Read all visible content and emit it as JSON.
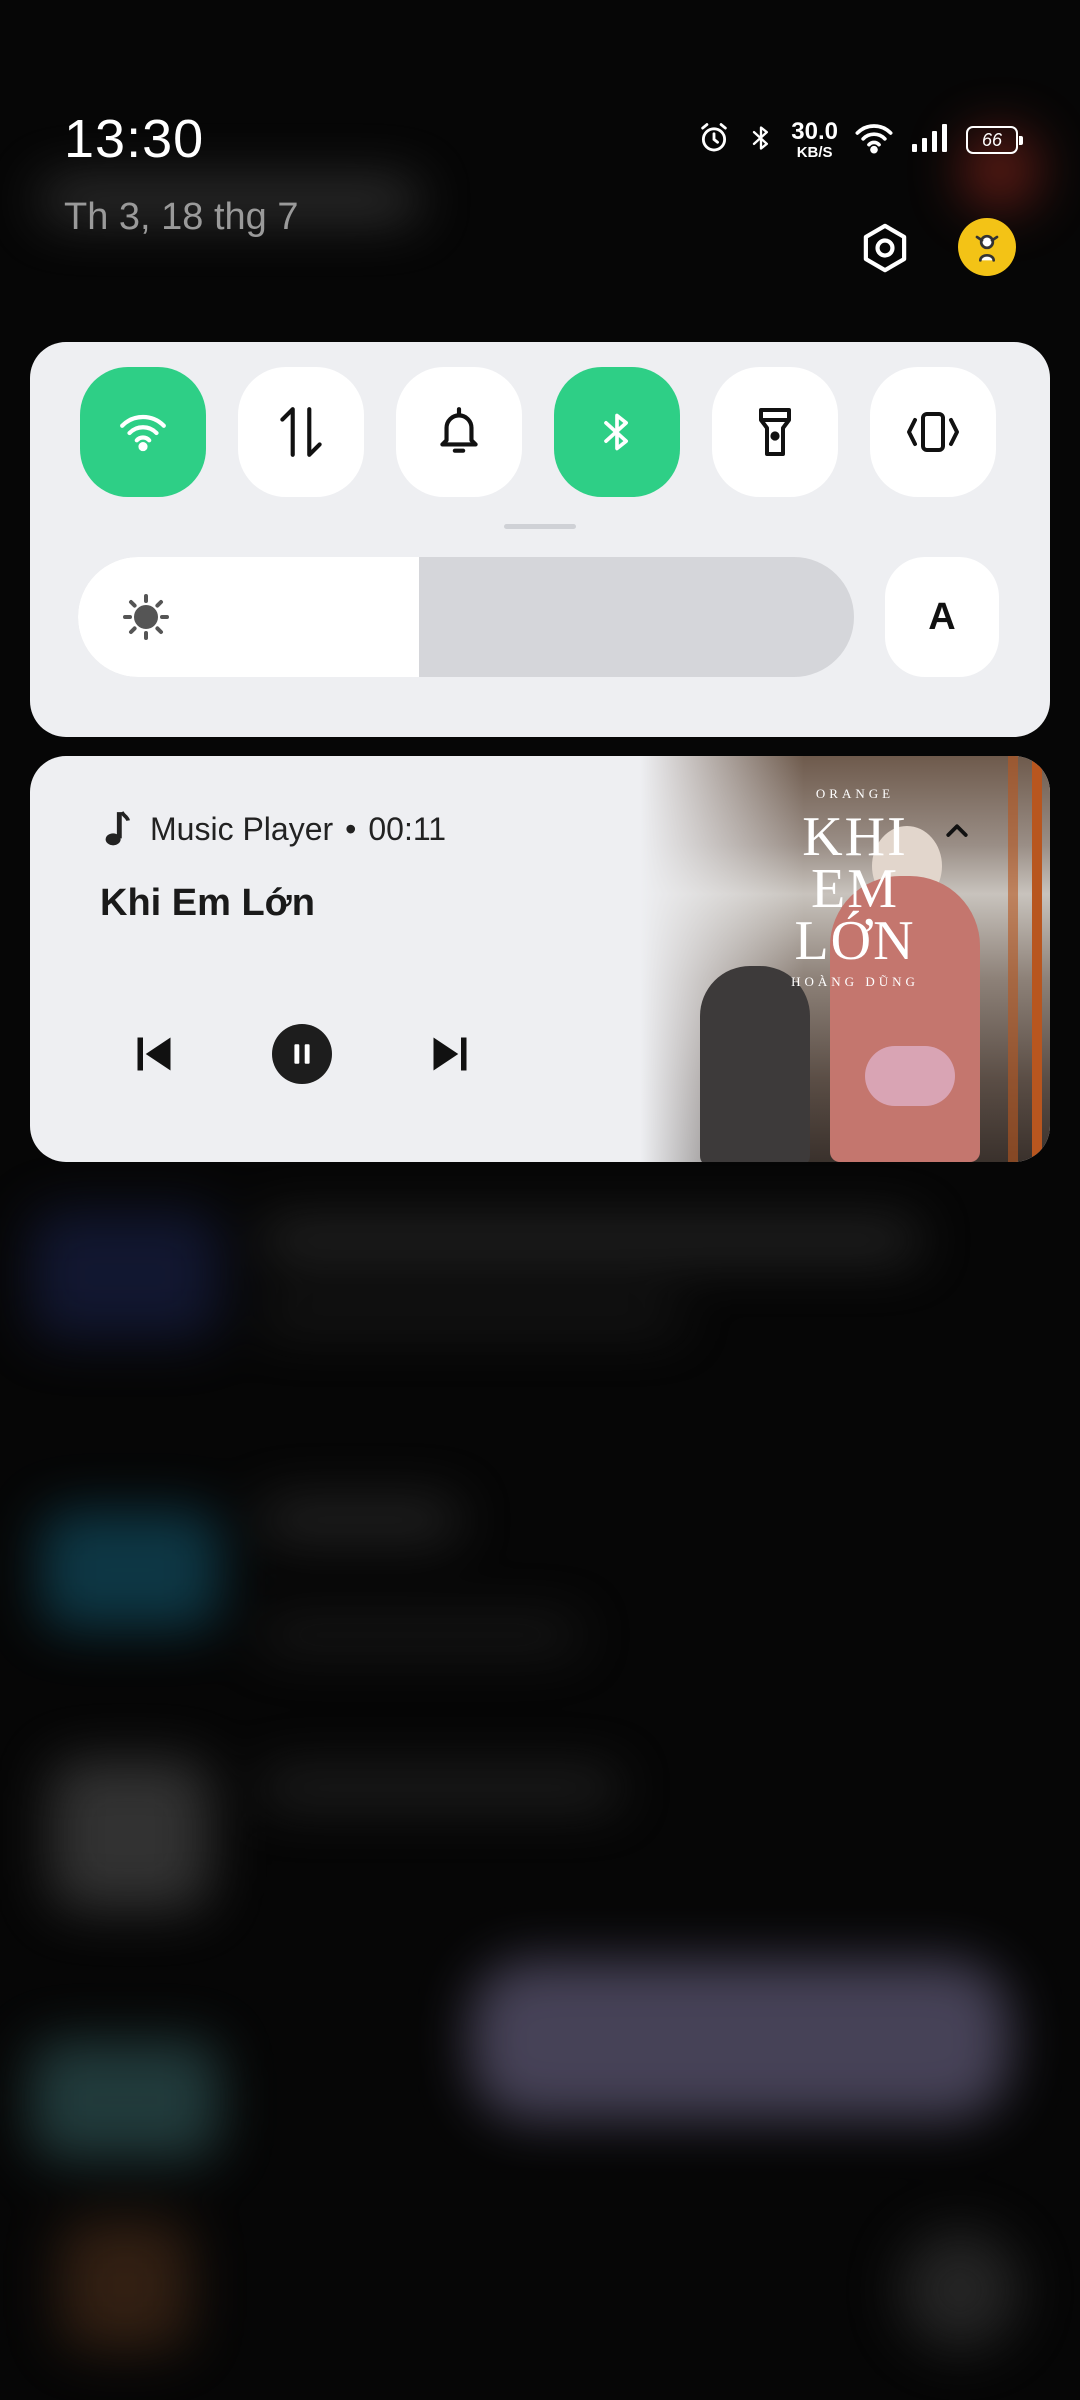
{
  "status_bar": {
    "time": "13:30",
    "date": "Th 3, 18 thg 7",
    "net_speed_value": "30.0",
    "net_speed_unit": "KB/S",
    "battery": "66",
    "icons": [
      "alarm-icon",
      "bluetooth-icon",
      "wifi-icon",
      "cell-signal-icon",
      "battery-icon"
    ]
  },
  "header_actions": {
    "icons": [
      "settings-icon",
      "user-avatar"
    ]
  },
  "quick_settings": {
    "tiles": [
      {
        "name": "wifi",
        "icon": "wifi-icon",
        "active": true
      },
      {
        "name": "mobile-data",
        "icon": "data-arrows-icon",
        "active": false
      },
      {
        "name": "sound",
        "icon": "bell-icon",
        "active": false
      },
      {
        "name": "bluetooth",
        "icon": "bluetooth-icon",
        "active": true
      },
      {
        "name": "flashlight",
        "icon": "flashlight-icon",
        "active": false
      },
      {
        "name": "vibrate",
        "icon": "vibrate-icon",
        "active": false
      }
    ],
    "brightness_level": 0.44,
    "auto_brightness_label": "A",
    "active_color": "#2ecf86"
  },
  "media": {
    "app": "Music Player",
    "separator": "•",
    "elapsed": "00:11",
    "title": "Khi Em Lớn",
    "album_art": {
      "top_text": "ORANGE",
      "title_line1": "KHI",
      "title_line2": "EM",
      "title_line3": "LỚN",
      "bottom_text": "HOÀNG DŨNG"
    },
    "controls": [
      "previous-icon",
      "pause-icon",
      "next-icon"
    ]
  }
}
